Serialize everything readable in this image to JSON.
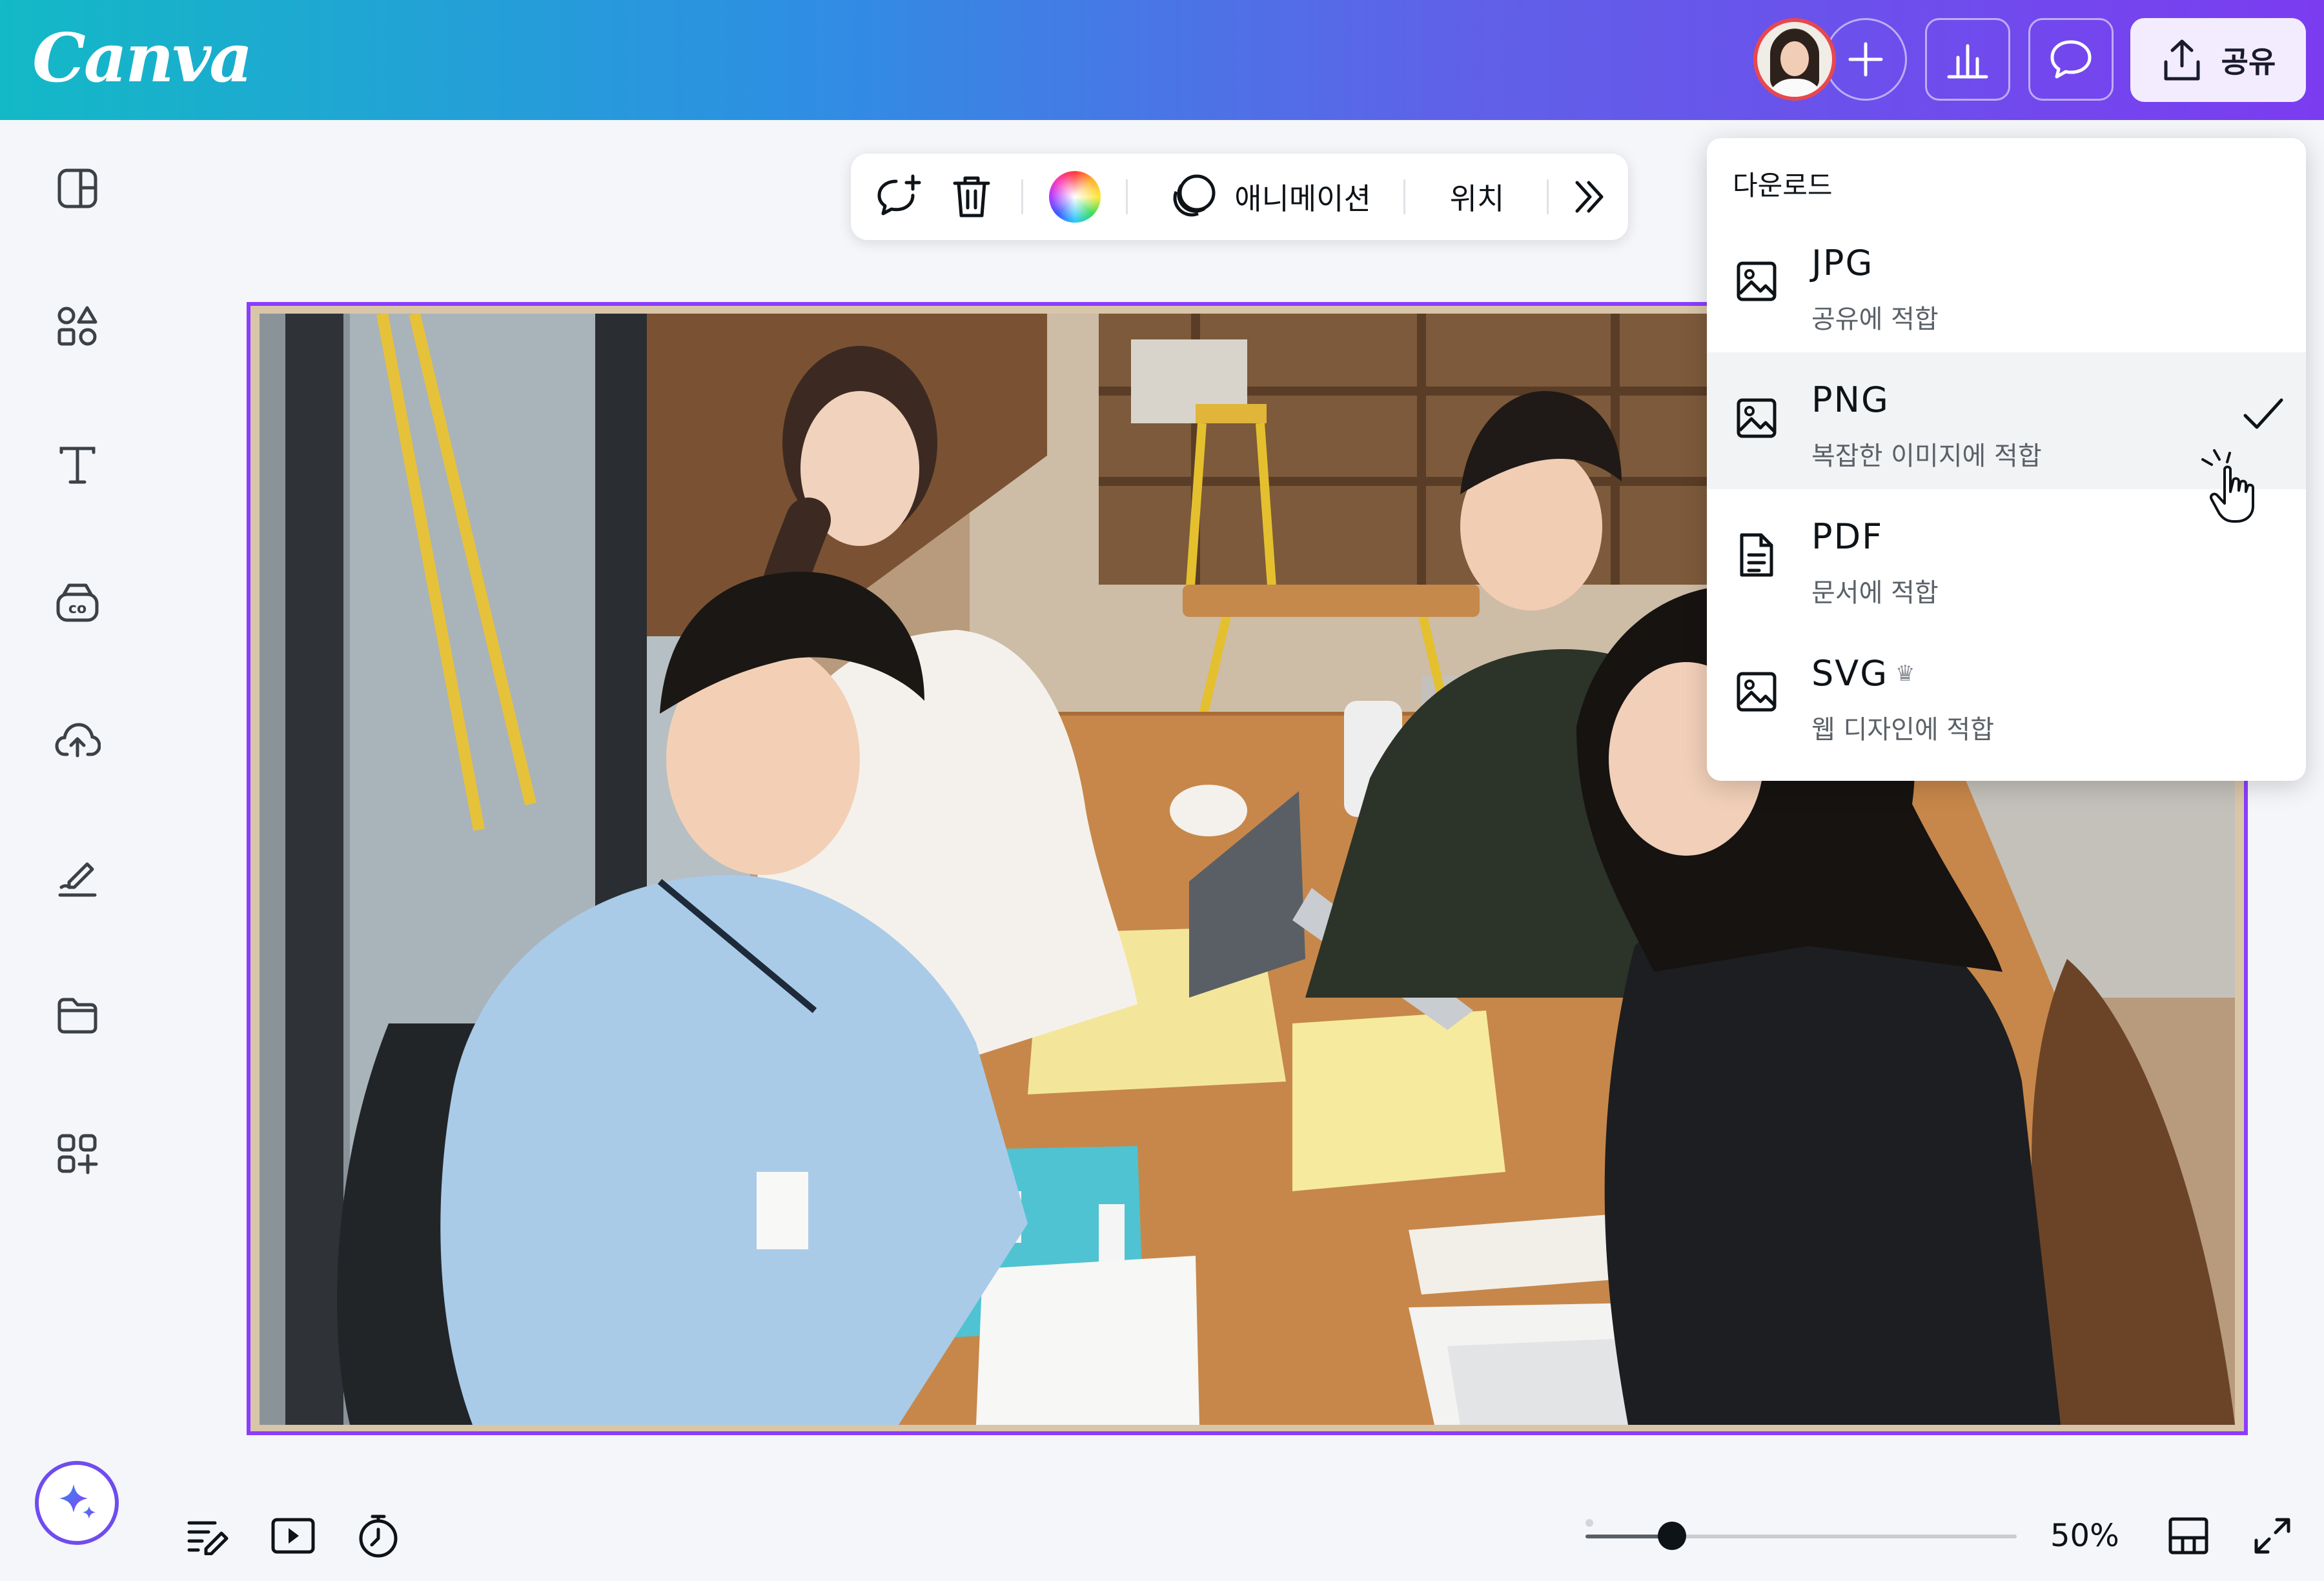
{
  "app": {
    "logo": "Canva",
    "share_label": "공유",
    "colors": {
      "accent": "#8b3dff",
      "header_start": "#13b9c6",
      "header_end": "#7b3cf0"
    }
  },
  "header": {
    "buttons": [
      "avatar",
      "add-icon",
      "insights-icon",
      "comment-icon"
    ]
  },
  "sidebar": {
    "items": [
      {
        "icon": "design-icon"
      },
      {
        "icon": "elements-icon"
      },
      {
        "icon": "text-icon"
      },
      {
        "icon": "brand-icon"
      },
      {
        "icon": "upload-cloud-icon"
      },
      {
        "icon": "draw-icon"
      },
      {
        "icon": "projects-folder-icon"
      },
      {
        "icon": "apps-icon"
      }
    ],
    "magic_icon": "sparkle-icon"
  },
  "toolbar": {
    "animate_label": "애니메이션",
    "position_label": "위치"
  },
  "download_menu": {
    "title": "다운로드",
    "items": [
      {
        "name": "JPG",
        "desc": "공유에 적합",
        "icon": "image-icon",
        "selected": false
      },
      {
        "name": "PNG",
        "desc": "복잡한 이미지에 적합",
        "icon": "image-icon",
        "selected": true
      },
      {
        "name": "PDF",
        "desc": "문서에 적합",
        "icon": "document-icon",
        "selected": false
      },
      {
        "name": "SVG",
        "desc": "웹 디자인에 적합",
        "icon": "image-icon",
        "selected": false,
        "premium": true
      }
    ]
  },
  "footer": {
    "zoom_label": "50%",
    "zoom_value": 0.2
  }
}
